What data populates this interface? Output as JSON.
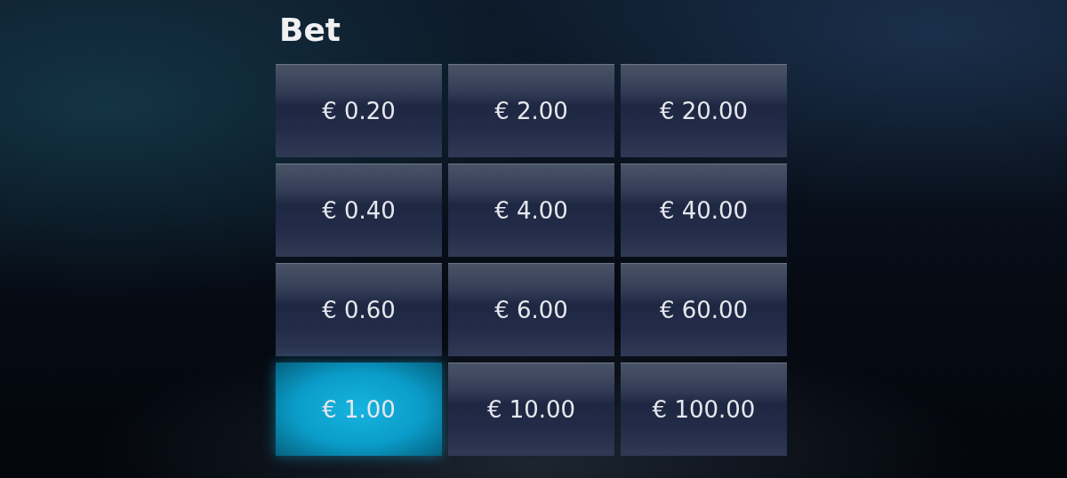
{
  "title": "Bet",
  "bets": [
    {
      "label": "€ 0.20",
      "selected": false
    },
    {
      "label": "€ 2.00",
      "selected": false
    },
    {
      "label": "€ 20.00",
      "selected": false
    },
    {
      "label": "€ 0.40",
      "selected": false
    },
    {
      "label": "€ 4.00",
      "selected": false
    },
    {
      "label": "€ 40.00",
      "selected": false
    },
    {
      "label": "€ 0.60",
      "selected": false
    },
    {
      "label": "€ 6.00",
      "selected": false
    },
    {
      "label": "€ 60.00",
      "selected": false
    },
    {
      "label": "€ 1.00",
      "selected": true
    },
    {
      "label": "€ 10.00",
      "selected": false
    },
    {
      "label": "€ 100.00",
      "selected": false
    }
  ]
}
